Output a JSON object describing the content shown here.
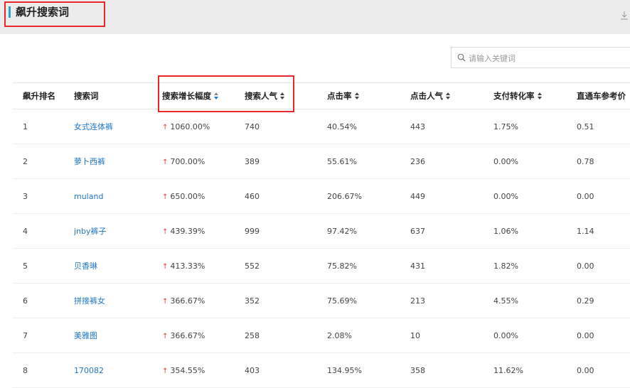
{
  "header": {
    "title": "飙升搜索词"
  },
  "search": {
    "placeholder": "请输入关键词"
  },
  "columns": [
    "飙升排名",
    "搜索词",
    "搜索增长幅度",
    "搜索人气",
    "点击率",
    "点击人气",
    "支付转化率",
    "直通车参考价"
  ],
  "rows": [
    {
      "rank": "1",
      "keyword": "女式连体裤",
      "growth": "1060.00%",
      "popularity": "740",
      "ctr": "40.54%",
      "click_pop": "443",
      "conversion": "1.75%",
      "price": "0.51"
    },
    {
      "rank": "2",
      "keyword": "萝卜西裤",
      "growth": "700.00%",
      "popularity": "389",
      "ctr": "55.61%",
      "click_pop": "236",
      "conversion": "0.00%",
      "price": "0.78"
    },
    {
      "rank": "3",
      "keyword": "muland",
      "growth": "650.00%",
      "popularity": "460",
      "ctr": "206.67%",
      "click_pop": "449",
      "conversion": "0.00%",
      "price": "0.00"
    },
    {
      "rank": "4",
      "keyword": "jnby裤子",
      "growth": "439.39%",
      "popularity": "999",
      "ctr": "97.42%",
      "click_pop": "637",
      "conversion": "1.06%",
      "price": "1.14"
    },
    {
      "rank": "5",
      "keyword": "贝香琳",
      "growth": "413.33%",
      "popularity": "552",
      "ctr": "75.82%",
      "click_pop": "431",
      "conversion": "1.82%",
      "price": "0.00"
    },
    {
      "rank": "6",
      "keyword": "拼接裤女",
      "growth": "366.67%",
      "popularity": "352",
      "ctr": "75.69%",
      "click_pop": "213",
      "conversion": "4.55%",
      "price": "0.29"
    },
    {
      "rank": "7",
      "keyword": "美雅图",
      "growth": "366.67%",
      "popularity": "258",
      "ctr": "2.08%",
      "click_pop": "10",
      "conversion": "0.00%",
      "price": "0.00"
    },
    {
      "rank": "8",
      "keyword": "170082",
      "growth": "354.55%",
      "popularity": "403",
      "ctr": "134.95%",
      "click_pop": "358",
      "conversion": "11.62%",
      "price": "0.00"
    }
  ],
  "colors": {
    "accent": "#2aa6c7",
    "link": "#1f77c5",
    "up_arrow": "#e43b3b",
    "highlight_box": "#e8282b"
  }
}
